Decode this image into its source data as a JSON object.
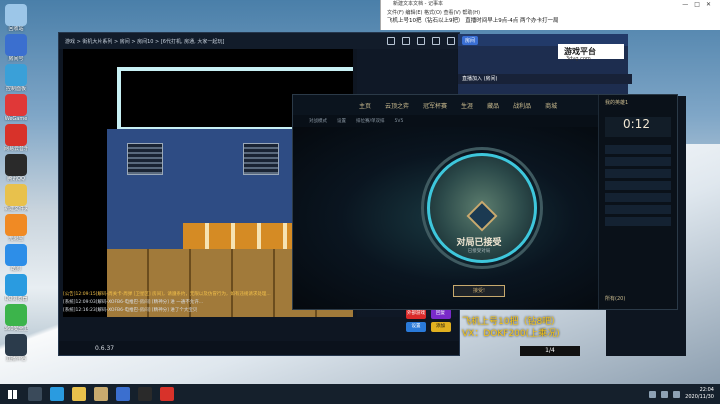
{
  "desktop_icons": [
    {
      "label": "回收站",
      "color": "#9cc6e8"
    },
    {
      "label": "房间号",
      "color": "#3b6fcf"
    },
    {
      "label": "控制面板",
      "color": "#3aa0d8"
    },
    {
      "label": "WeGame",
      "color": "#e03838"
    },
    {
      "label": "网易云音乐",
      "color": "#d8322a"
    },
    {
      "label": "腾讯QQ",
      "color": "#2a2a2a"
    },
    {
      "label": "新建文件夹",
      "color": "#e8c14c"
    },
    {
      "label": "无限宝",
      "color": "#f08a24"
    },
    {
      "label": "酷狗",
      "color": "#2d8ee8"
    },
    {
      "label": "QQ浏览器",
      "color": "#2a9be0"
    },
    {
      "label": "360安全卫士",
      "color": "#3cb44b"
    },
    {
      "label": "直播伴侣",
      "color": "#2b3b4b"
    }
  ],
  "notepad": {
    "title": "新建文本文档 - 记事本",
    "menu": "文件(F)  编辑(E)  格式(O)  查看(V)  帮助(H)",
    "text": "飞机上号10把（钻石以上9把）   直播时间早上9点-4点    两个办卡打一局"
  },
  "game": {
    "breadcrumb": "游戏 > 街机大片系列 > 房间 > 房间10 > [6代打机, 房通, 大家一起玩]",
    "chat_lines": [
      "[公告]12:09:15[解码-周关卡-周弹 [卫星区] 房间]，请遵条约，无限以及仿冒行为，如有违规请求处理...",
      "[系统]12:09:03[解码-XOFB6-电推巴-房间] [精神分] 进 一通不允许...",
      "[系统]12:16:23[解码-XOFB6-电推巴-房间] [精神分] 进了个大宝贝"
    ],
    "version": "0.6.37",
    "buttons": [
      "外部游戏",
      "回复",
      "设置",
      "添加"
    ]
  },
  "stream": {
    "tab": "房间",
    "logo": "游戏平台",
    "sub": "3dvg.com",
    "bar": "直播加入         (房间)"
  },
  "lol": {
    "nav": [
      "主页",
      "云顶之弈",
      "冠军杯赛",
      "生涯",
      "藏品",
      "战利品",
      "商城"
    ],
    "sub": [
      "对战模式",
      "设置",
      "排位赛/单双排",
      "5V5"
    ],
    "username": "我的英雄1",
    "timer": "0:12",
    "accept_title": "对局已接受",
    "accept_sub": "已接受对局",
    "accept_button": "接受!",
    "friend_count": "所有(20)"
  },
  "overlay": {
    "line1": "飞机上号10把（钻8吧）",
    "line2": "VX：DOKF200(上乘况)",
    "pager": "1/4"
  },
  "taskbar": {
    "time": "22:04",
    "date": "2020/11/30"
  }
}
